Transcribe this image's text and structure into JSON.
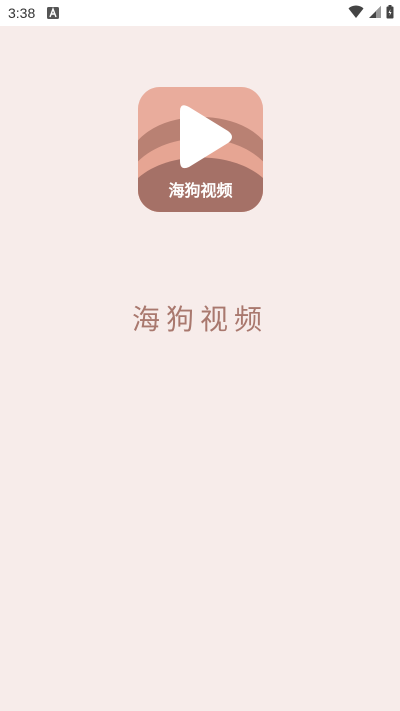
{
  "status_bar": {
    "time": "3:38",
    "notification_icon": "a-icon",
    "wifi_icon": "wifi-icon",
    "signal_icon": "signal-icon",
    "battery_icon": "battery-icon"
  },
  "splash": {
    "logo_text": "海狗视频",
    "app_name": "海狗视频"
  },
  "colors": {
    "background": "#f7ecea",
    "logo_light": "#e9a999",
    "logo_dark": "#a57167",
    "title": "#a9786e"
  }
}
